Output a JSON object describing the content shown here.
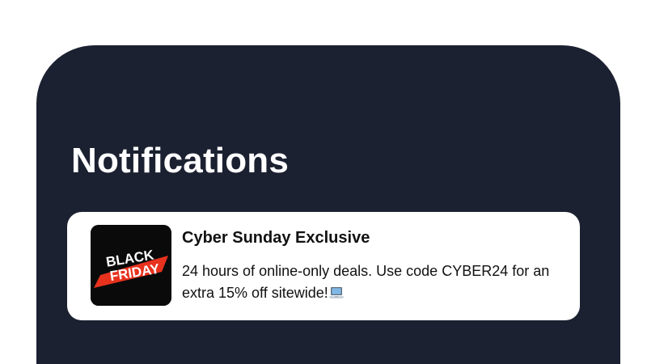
{
  "notifications": {
    "title": "Notifications",
    "items": [
      {
        "image": {
          "icon": "black-friday-badge",
          "lines": [
            "BLACK",
            "FRIDAY"
          ],
          "accent_color": "#e8321e"
        },
        "title": "Cyber Sunday Exclusive",
        "body": "24 hours of online-only deals. Use code CYBER24 for an extra 15% off sitewide!",
        "trailing_icon": "laptop-icon"
      }
    ]
  },
  "colors": {
    "page_background": "#ffffff",
    "panel_background": "#1c2131",
    "card_background": "#ffffff",
    "text_primary": "#111111"
  }
}
